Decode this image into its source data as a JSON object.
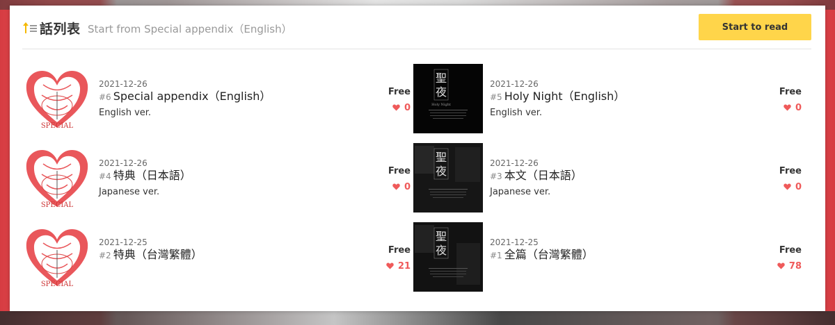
{
  "header": {
    "title": "話列表",
    "subtitle": "Start from Special appendix（English）",
    "read_button": "Start to read"
  },
  "episodes": [
    {
      "date": "2021-12-26",
      "number": "#6",
      "title": "Special appendix（English）",
      "desc": "English ver.",
      "price": "Free",
      "likes": "0",
      "thumb": "special-heart"
    },
    {
      "date": "2021-12-26",
      "number": "#5",
      "title": "Holy Night（English）",
      "desc": "English ver.",
      "price": "Free",
      "likes": "0",
      "thumb": "holy-night-cover"
    },
    {
      "date": "2021-12-26",
      "number": "#4",
      "title": "特典（日本語）",
      "desc": "Japanese ver.",
      "price": "Free",
      "likes": "0",
      "thumb": "special-heart"
    },
    {
      "date": "2021-12-26",
      "number": "#3",
      "title": "本文（日本語）",
      "desc": "Japanese ver.",
      "price": "Free",
      "likes": "0",
      "thumb": "holy-night-cover"
    },
    {
      "date": "2021-12-25",
      "number": "#2",
      "title": "特典（台灣繁體）",
      "desc": "",
      "price": "Free",
      "likes": "21",
      "thumb": "special-heart"
    },
    {
      "date": "2021-12-25",
      "number": "#1",
      "title": "全篇（台灣繁體）",
      "desc": "",
      "price": "Free",
      "likes": "78",
      "thumb": "holy-night-cover"
    }
  ],
  "thumb_text": {
    "heart_caption": "SPECIAL",
    "cover_title_1": "聖",
    "cover_title_2": "夜",
    "cover_caption": "Holy Night"
  },
  "colors": {
    "accent_yellow": "#ffd54a",
    "like_red": "#ef5a5a",
    "sort_icon_yellow": "#f5b800"
  }
}
